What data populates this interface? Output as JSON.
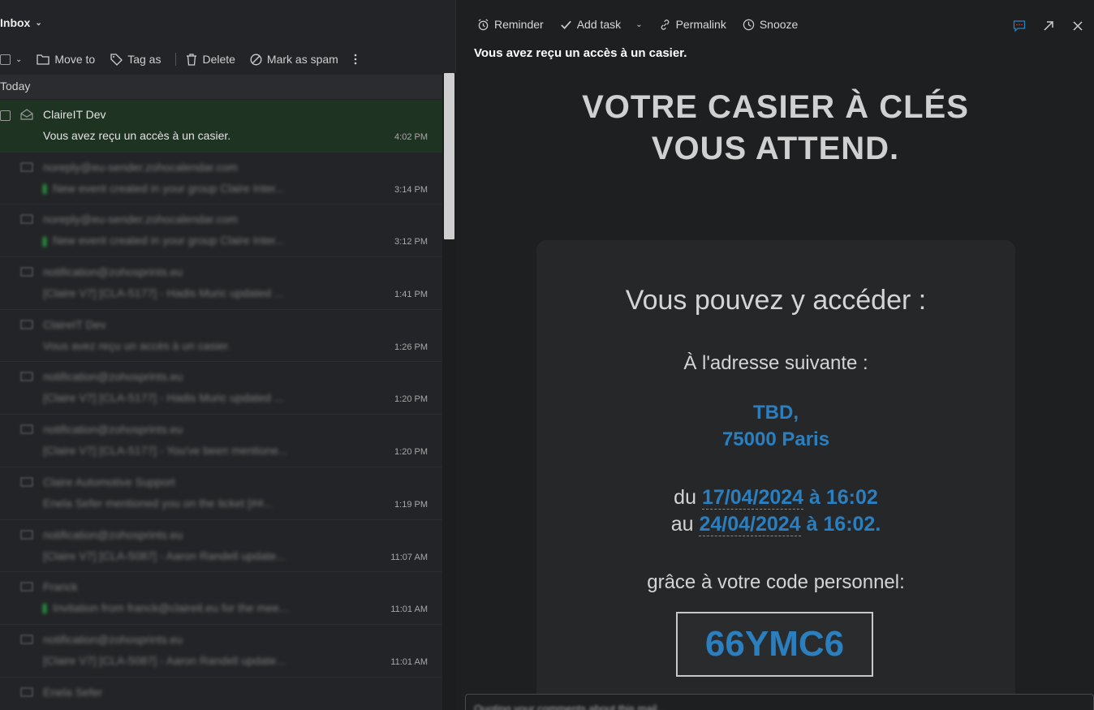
{
  "inbox": {
    "title": "Inbox"
  },
  "toolbar": {
    "move_to": "Move to",
    "tag_as": "Tag as",
    "delete": "Delete",
    "mark_spam": "Mark as spam"
  },
  "list": {
    "section": "Today",
    "items": [
      {
        "from": "ClaireIT Dev",
        "subject": "Vous avez reçu un accès à un casier.",
        "time": "4:02 PM"
      },
      {
        "from": "noreply@eu-sender.zohocalendar.com",
        "subject": "New event created in your group Claire Inter...",
        "time": "3:14 PM"
      },
      {
        "from": "noreply@eu-sender.zohocalendar.com",
        "subject": "New event created in your group Claire Inter...",
        "time": "3:12 PM"
      },
      {
        "from": "notification@zohosprints.eu",
        "subject": "[Claire V7] [CLA-5177] - Hadis Muric updated ...",
        "time": "1:41 PM"
      },
      {
        "from": "ClaireIT Dev",
        "subject": "Vous avez reçu un accès à un casier.",
        "time": "1:26 PM"
      },
      {
        "from": "notification@zohosprints.eu",
        "subject": "[Claire V7] [CLA-5177] - Hadis Muric updated ...",
        "time": "1:20 PM"
      },
      {
        "from": "notification@zohosprints.eu",
        "subject": "[Claire V7] [CLA-5177] - You've been mentione...",
        "time": "1:20 PM"
      },
      {
        "from": "Claire Automotive Support",
        "subject": "Enela Sefer mentioned you on the ticket [##...",
        "time": "1:19 PM"
      },
      {
        "from": "notification@zohosprints.eu",
        "subject": "[Claire V7] [CLA-5087] - Aaron Randell update...",
        "time": "11:07 AM"
      },
      {
        "from": "Franck",
        "subject": "Invitation from franck@claireit.eu for the mee...",
        "time": "11:01 AM"
      },
      {
        "from": "notification@zohosprints.eu",
        "subject": "[Claire V7] [CLA-5087] - Aaron Randell update...",
        "time": "11:01 AM"
      },
      {
        "from": "Enela Sefer",
        "subject": "",
        "time": ""
      }
    ]
  },
  "reader": {
    "tools": {
      "reminder": "Reminder",
      "add_task": "Add task",
      "permalink": "Permalink",
      "snooze": "Snooze"
    },
    "subject": "Vous avez reçu un accès à un casier.",
    "headline_1": "VOTRE CASIER À CLÉS",
    "headline_2": "VOUS ATTEND.",
    "card": {
      "title": "Vous pouvez y accéder :",
      "addr_label": "À l'adresse suivante :",
      "addr_1": "TBD,",
      "addr_2": "75000 Paris",
      "du": "du",
      "au": "au",
      "date1": "17/04/2024",
      "time1": "à 16:02",
      "date2": "24/04/2024",
      "time2": "à 16:02.",
      "code_label": "grâce à votre code personnel:",
      "code": "66YMC6"
    },
    "reply_placeholder": "Quoting your comments about this mail..."
  },
  "colors": {
    "accent": "#2b7fbf",
    "active_row": "#1f3323",
    "unread_marker": "#27a844"
  }
}
